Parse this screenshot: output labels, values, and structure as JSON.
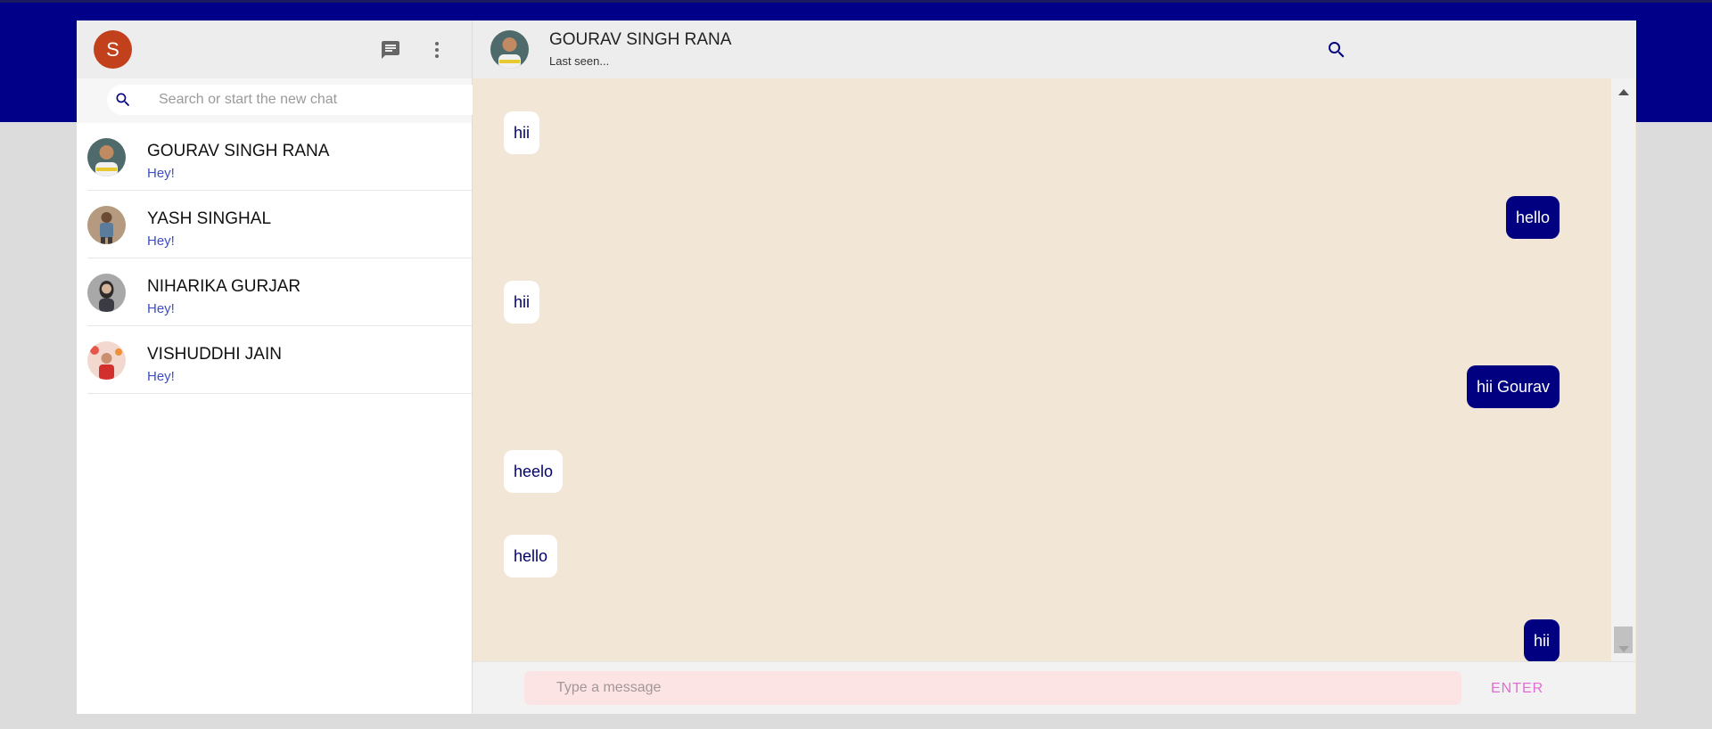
{
  "user": {
    "initial": "S",
    "avatar_color": "#c2401b"
  },
  "sidebar": {
    "search": {
      "placeholder": "Search or start the new chat",
      "value": ""
    },
    "contacts": [
      {
        "name": "GOURAV SINGH RANA",
        "last_message": "Hey!"
      },
      {
        "name": "YASH SINGHAL",
        "last_message": "Hey!"
      },
      {
        "name": "NIHARIKA GURJAR",
        "last_message": "Hey!"
      },
      {
        "name": "VISHUDDHI JAIN",
        "last_message": "Hey!"
      }
    ]
  },
  "chat": {
    "contact_name": "GOURAV SINGH RANA",
    "status": "Last seen...",
    "messages": [
      {
        "text": "hii",
        "direction": "in"
      },
      {
        "text": "hello",
        "direction": "out"
      },
      {
        "text": "hii",
        "direction": "in"
      },
      {
        "text": "hii Gourav",
        "direction": "out"
      },
      {
        "text": "heelo",
        "direction": "in"
      },
      {
        "text": "hello",
        "direction": "in"
      },
      {
        "text": "hii",
        "direction": "out"
      }
    ],
    "input": {
      "placeholder": "Type a message",
      "value": ""
    },
    "enter_label": "ENTER"
  },
  "colors": {
    "brand": "#000080",
    "chat_background": "#f2e6d6",
    "enter_text": "#e46bd3",
    "input_background": "#fde4e4"
  }
}
